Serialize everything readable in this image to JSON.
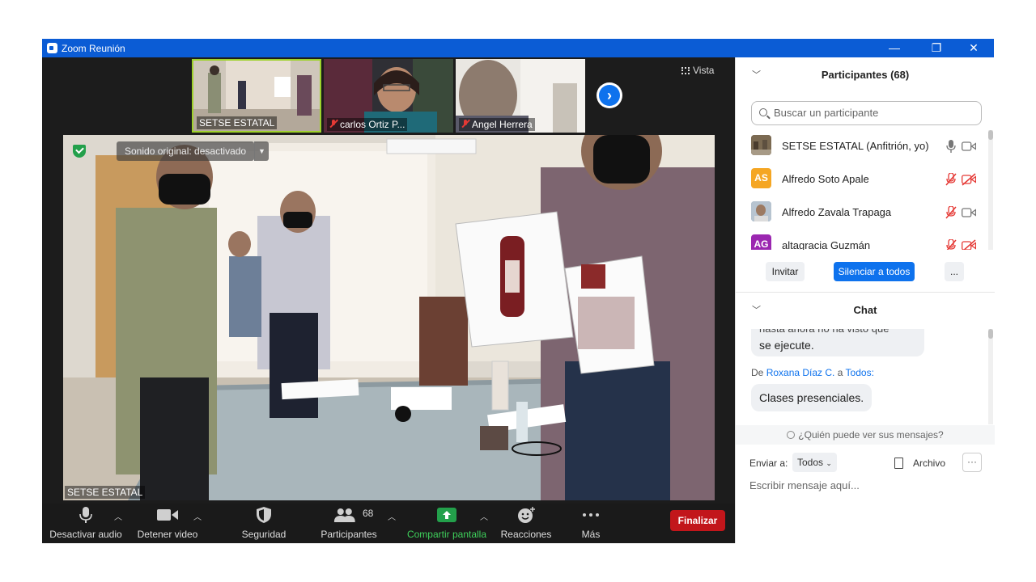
{
  "window": {
    "title": "Zoom Reunión",
    "minimize_glyph": "—",
    "restore_glyph": "❐",
    "close_glyph": "✕"
  },
  "video": {
    "thumbnails": [
      {
        "name": "SETSE ESTATAL",
        "muted": false
      },
      {
        "name": "carlos Ortiz P...",
        "muted": true
      },
      {
        "name": "Angel Herrera",
        "muted": true
      }
    ],
    "view_label": "Vista",
    "sound_pill": "Sonido original: desactivado",
    "main_speaker": "SETSE ESTATAL"
  },
  "toolbar": {
    "mute": "Desactivar audio",
    "video": "Detener video",
    "security": "Seguridad",
    "participants": "Participantes",
    "participants_count": "68",
    "share": "Compartir pantalla",
    "reactions": "Reacciones",
    "more": "Más",
    "end": "Finalizar"
  },
  "participants": {
    "header": "Participantes (68)",
    "search_placeholder": "Buscar un participante",
    "list": [
      {
        "name": "SETSE ESTATAL (Anfitrión, yo)",
        "initials": "",
        "avatar_color": "#6b5b45",
        "mic": "on",
        "video": "on"
      },
      {
        "name": "Alfredo Soto Apale",
        "initials": "AS",
        "avatar_color": "#f5a623",
        "mic": "off",
        "video": "off"
      },
      {
        "name": "Alfredo Zavala Trapaga",
        "initials": "",
        "avatar_color": "#8aa0b8",
        "mic": "off",
        "video": "on"
      },
      {
        "name": "altagracia Guzmán",
        "initials": "AG",
        "avatar_color": "#9b27b0",
        "mic": "off",
        "video": "off"
      }
    ],
    "invite": "Invitar",
    "mute_all": "Silenciar a todos",
    "more": "..."
  },
  "chat": {
    "header": "Chat",
    "partial_message": "hasta ahora no ha visto que",
    "partial_message_2": "se ejecute.",
    "from_prefix": "De",
    "from_name": "Roxana Díaz C.",
    "to_word": "a",
    "to_name": "Todos:",
    "message": "Clases presenciales.",
    "who_sees": "¿Quién puede ver sus mensajes?",
    "send_to_label": "Enviar a:",
    "send_to_value": "Todos",
    "file_label": "Archivo",
    "compose_placeholder": "Escribir mensaje aquí...",
    "more": "···"
  },
  "colors": {
    "titlebar": "#0b5cd5",
    "accent_blue": "#0e72ed",
    "end_red": "#c2161b",
    "share_green": "#23a04b",
    "muted_red": "#e53935"
  }
}
